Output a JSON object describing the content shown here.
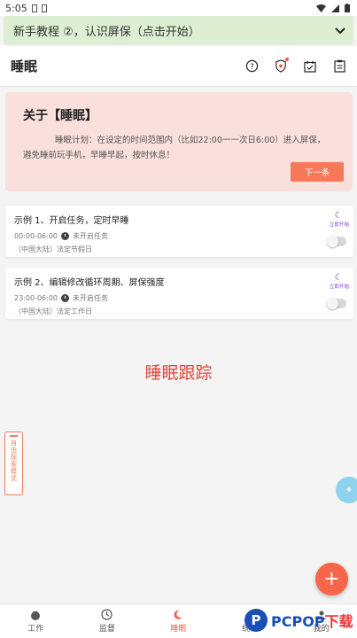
{
  "status_bar": {
    "time": "5:05"
  },
  "tutorial": {
    "text": "新手教程 ②，认识屏保（点击开始）"
  },
  "header": {
    "title": "睡眠"
  },
  "about": {
    "title": "关于【睡眠】",
    "text": "睡眠计划：在设定的时间范围内（比如22:00一一次日6:00）进入屏保，避免睡前玩手机，早睡早起，按时休息！",
    "next_label": "下一条"
  },
  "tasks": [
    {
      "title": "示例 1、开启任务，定时早睡",
      "time": "00:00-06:00",
      "status": "未开启任务",
      "holiday": "（中国大陆）法定节假日",
      "start_label": "立即开始"
    },
    {
      "title": "示例 2、编辑修改循环周期、屏保强度",
      "time": "23:00-06:00",
      "status": "未开启任务",
      "holiday": "（中国大陆）法定工作日",
      "start_label": "立即开始"
    }
  ],
  "tracking_label": "睡眠跟踪",
  "side_tab": {
    "text": "自由探索模式"
  },
  "fab": {
    "label": "+"
  },
  "bottom_nav": [
    {
      "label": "工作",
      "icon": "tomato-icon"
    },
    {
      "label": "监督",
      "icon": "clock-icon"
    },
    {
      "label": "睡眠",
      "icon": "moon-icon"
    },
    {
      "label": "统计",
      "icon": "chart-icon"
    },
    {
      "label": "我的",
      "icon": "user-icon"
    }
  ],
  "watermark": {
    "text_main": "PCPOP",
    "text_accent": "下载"
  },
  "colors": {
    "accent": "#f7654a",
    "tutorial_bg": "#dcefd3",
    "about_bg": "#f9e0dc",
    "moon": "#7b3fb8"
  }
}
